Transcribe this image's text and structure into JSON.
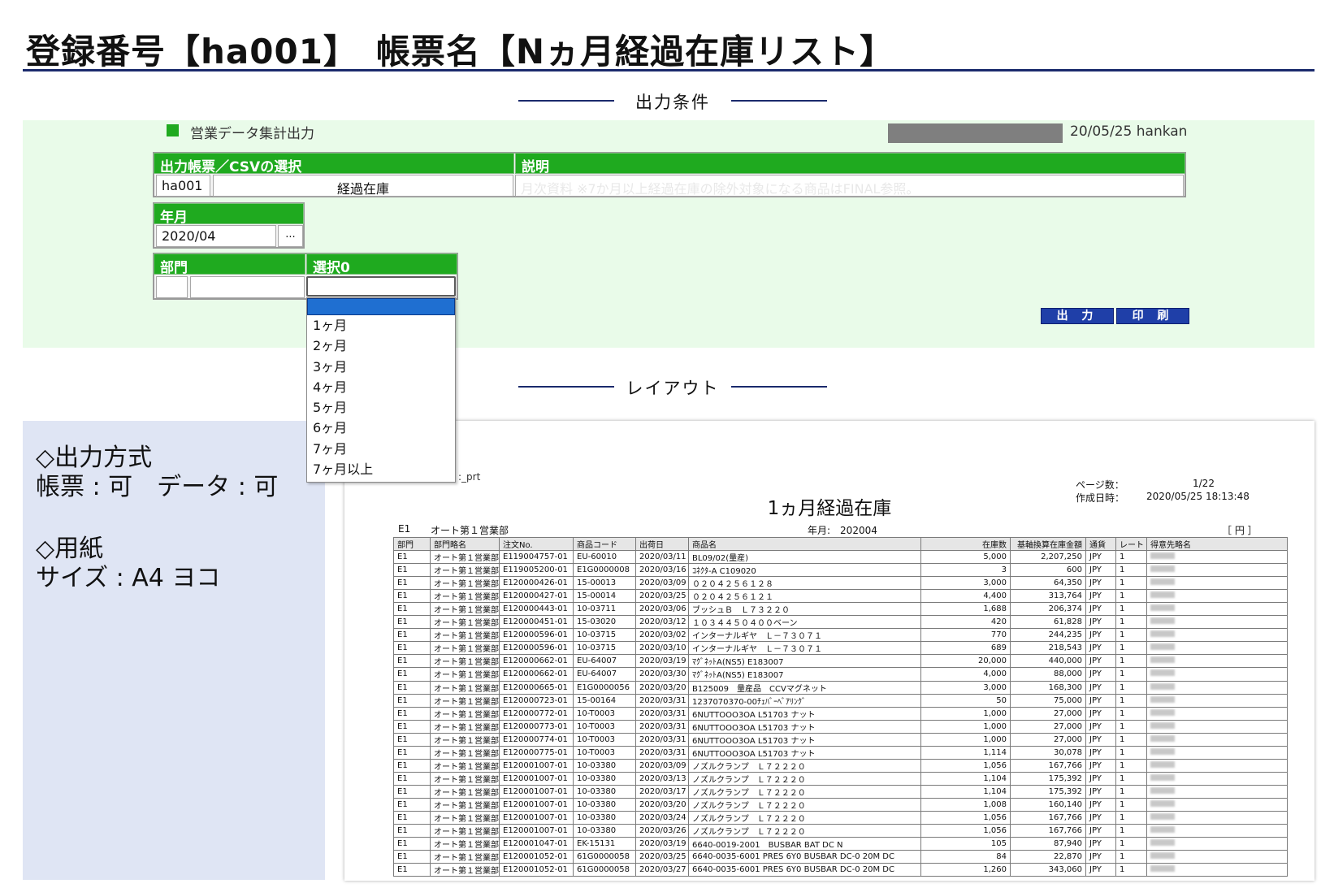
{
  "title": "登録番号【ha001】　帳票名【Nヵ月経過在庫リスト】",
  "sections": {
    "conditions": "出力条件",
    "layout": "レイアウト"
  },
  "conditions": {
    "label": "営業データ集計出力",
    "user": "20/05/25 hankan",
    "report_select_header": "出力帳票／CSVの選択",
    "description_header": "説明",
    "report_code": "ha001",
    "report_name": "経過在庫",
    "description": "月次資料 ※7か月以上経過在庫の除外対象になる商品はFINAL参照。",
    "yearmonth_header": "年月",
    "yearmonth_value": "2020/04",
    "picker_label": "...",
    "dept_header": "部門",
    "select_header": "選択0",
    "output_button": "出 力",
    "print_button": "印 刷",
    "dropdown_options": [
      "1ヶ月",
      "2ヶ月",
      "3ヶ月",
      "4ヶ月",
      "5ヶ月",
      "6ヶ月",
      "7ヶ月",
      "7ヶ月以上"
    ]
  },
  "info": {
    "method_heading": "◇出力方式",
    "method_value": "帳票 : 可　データ : 可",
    "paper_heading": "◇用紙",
    "paper_value": "サイズ : A4 ヨコ"
  },
  "report": {
    "prt_label": ":_prt",
    "title": "1ヵ月経過在庫",
    "page_label": "ページ数：",
    "page_value": "1/22",
    "created_label": "作成日時：",
    "created_value": "2020/05/25 18:13:48",
    "dept_code": "E1",
    "dept_name": "オート第１営業部",
    "yearmonth": "年月:　202004",
    "unit": "［ 円 ］",
    "headers": [
      "部門",
      "部門略名",
      "注文No.",
      "商品コード",
      "出荷日",
      "商品名",
      "在庫数",
      "基軸換算在庫金額",
      "通貨",
      "レート",
      "得意先略名"
    ],
    "rows": [
      [
        "E1",
        "オート第１営業部",
        "E119004757-01",
        "EU-60010",
        "2020/03/11",
        "BL09/02(量産)",
        "5,000",
        "2,207,250",
        "JPY",
        "1"
      ],
      [
        "E1",
        "オート第１営業部",
        "E119005200-01",
        "E1G0000008",
        "2020/03/16",
        "ｺﾈｸﾀ-A C109020",
        "3",
        "600",
        "JPY",
        "1"
      ],
      [
        "E1",
        "オート第１営業部",
        "E120000426-01",
        "15-00013",
        "2020/03/09",
        "０２０４２５６１２８",
        "3,000",
        "64,350",
        "JPY",
        "1"
      ],
      [
        "E1",
        "オート第１営業部",
        "E120000427-01",
        "15-00014",
        "2020/03/25",
        "０２０４２５６１２１",
        "4,400",
        "313,764",
        "JPY",
        "1"
      ],
      [
        "E1",
        "オート第１営業部",
        "E120000443-01",
        "10-03711",
        "2020/03/06",
        "ブッシュＢ　Ｌ７３２２０",
        "1,688",
        "206,374",
        "JPY",
        "1"
      ],
      [
        "E1",
        "オート第１営業部",
        "E120000451-01",
        "15-03020",
        "2020/03/12",
        "１０３４４５０４００ベーン",
        "420",
        "61,828",
        "JPY",
        "1"
      ],
      [
        "E1",
        "オート第１営業部",
        "E120000596-01",
        "10-03715",
        "2020/03/02",
        "インターナルギヤ　Ｌ－７３０７１",
        "770",
        "244,235",
        "JPY",
        "1"
      ],
      [
        "E1",
        "オート第１営業部",
        "E120000596-01",
        "10-03715",
        "2020/03/10",
        "インターナルギヤ　Ｌ－７３０７１",
        "689",
        "218,543",
        "JPY",
        "1"
      ],
      [
        "E1",
        "オート第１営業部",
        "E120000662-01",
        "EU-64007",
        "2020/03/19",
        "ﾏｸﾞﾈｯﾄA(NS5) E183007",
        "20,000",
        "440,000",
        "JPY",
        "1"
      ],
      [
        "E1",
        "オート第１営業部",
        "E120000662-01",
        "EU-64007",
        "2020/03/30",
        "ﾏｸﾞﾈｯﾄA(NS5) E183007",
        "4,000",
        "88,000",
        "JPY",
        "1"
      ],
      [
        "E1",
        "オート第１営業部",
        "E120000665-01",
        "E1G0000056",
        "2020/03/20",
        "B125009　量産品　CCVマグネット",
        "3,000",
        "168,300",
        "JPY",
        "1"
      ],
      [
        "E1",
        "オート第１営業部",
        "E120000723-01",
        "15-00164",
        "2020/03/31",
        "1237070370-00ﾁｪﾊﾞｰﾍﾞｱﾘﾝｸﾞ",
        "50",
        "75,000",
        "JPY",
        "1"
      ],
      [
        "E1",
        "オート第１営業部",
        "E120000772-01",
        "10-T0003",
        "2020/03/31",
        "6NUTTOOO3OA L51703 ナット",
        "1,000",
        "27,000",
        "JPY",
        "1"
      ],
      [
        "E1",
        "オート第１営業部",
        "E120000773-01",
        "10-T0003",
        "2020/03/31",
        "6NUTTOOO3OA L51703 ナット",
        "1,000",
        "27,000",
        "JPY",
        "1"
      ],
      [
        "E1",
        "オート第１営業部",
        "E120000774-01",
        "10-T0003",
        "2020/03/31",
        "6NUTTOOO3OA L51703 ナット",
        "1,000",
        "27,000",
        "JPY",
        "1"
      ],
      [
        "E1",
        "オート第１営業部",
        "E120000775-01",
        "10-T0003",
        "2020/03/31",
        "6NUTTOOO3OA L51703 ナット",
        "1,114",
        "30,078",
        "JPY",
        "1"
      ],
      [
        "E1",
        "オート第１営業部",
        "E120001007-01",
        "10-03380",
        "2020/03/09",
        "ノズルクランプ　Ｌ７２２２０",
        "1,056",
        "167,766",
        "JPY",
        "1"
      ],
      [
        "E1",
        "オート第１営業部",
        "E120001007-01",
        "10-03380",
        "2020/03/13",
        "ノズルクランプ　Ｌ７２２２０",
        "1,104",
        "175,392",
        "JPY",
        "1"
      ],
      [
        "E1",
        "オート第１営業部",
        "E120001007-01",
        "10-03380",
        "2020/03/17",
        "ノズルクランプ　Ｌ７２２２０",
        "1,104",
        "175,392",
        "JPY",
        "1"
      ],
      [
        "E1",
        "オート第１営業部",
        "E120001007-01",
        "10-03380",
        "2020/03/20",
        "ノズルクランプ　Ｌ７２２２０",
        "1,008",
        "160,140",
        "JPY",
        "1"
      ],
      [
        "E1",
        "オート第１営業部",
        "E120001007-01",
        "10-03380",
        "2020/03/24",
        "ノズルクランプ　Ｌ７２２２０",
        "1,056",
        "167,766",
        "JPY",
        "1"
      ],
      [
        "E1",
        "オート第１営業部",
        "E120001007-01",
        "10-03380",
        "2020/03/26",
        "ノズルクランプ　Ｌ７２２２０",
        "1,056",
        "167,766",
        "JPY",
        "1"
      ],
      [
        "E1",
        "オート第１営業部",
        "E120001047-01",
        "EK-15131",
        "2020/03/19",
        "6640-0019-2001　BUSBAR BAT DC N",
        "105",
        "87,940",
        "JPY",
        "1"
      ],
      [
        "E1",
        "オート第１営業部",
        "E120001052-01",
        "61G0000058",
        "2020/03/25",
        "6640-0035-6001 PRES 6Y0 BUSBAR DC-0 20M DC",
        "84",
        "22,870",
        "JPY",
        "1"
      ],
      [
        "E1",
        "オート第１営業部",
        "E120001052-01",
        "61G0000058",
        "2020/03/27",
        "6640-0035-6001 PRES 6Y0 BUSBAR DC-0 20M DC",
        "1,260",
        "343,060",
        "JPY",
        "1"
      ]
    ]
  }
}
